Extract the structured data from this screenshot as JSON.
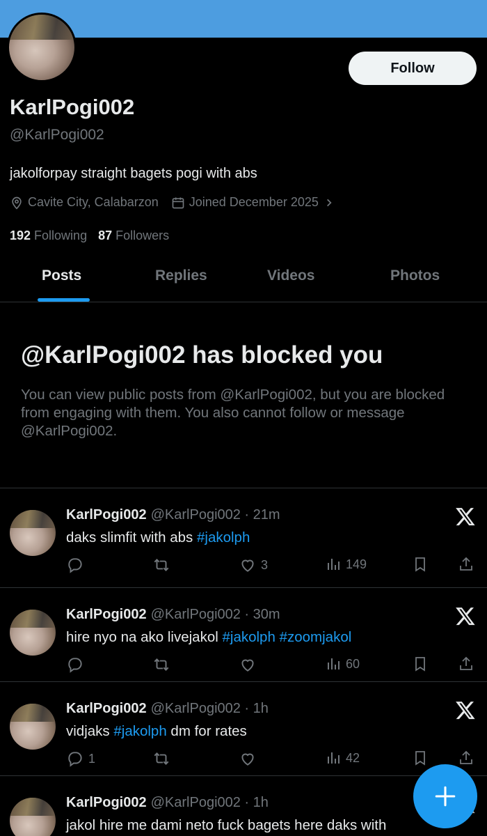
{
  "profile": {
    "name": "KarlPogi002",
    "handle": "@KarlPogi002",
    "bio": "jakolforpay straight bagets pogi with abs",
    "location": "Cavite City, Calabarzon",
    "joined": "Joined December 2025",
    "following_count": "192",
    "following_label": "Following",
    "followers_count": "87",
    "followers_label": "Followers",
    "follow_label": "Follow"
  },
  "tabs": [
    "Posts",
    "Replies",
    "Videos",
    "Photos"
  ],
  "blocked": {
    "title": "@KarlPogi002 has blocked you",
    "description": "You can view public posts from @KarlPogi002, but you are blocked from engaging with them. You also cannot follow or message @KarlPogi002."
  },
  "posts": [
    {
      "name": "KarlPogi002",
      "meta": "@KarlPogi002 · 21m",
      "text_parts": [
        {
          "t": "daks slimfit with abs ",
          "tag": false
        },
        {
          "t": "#jakolph",
          "tag": true
        }
      ],
      "replies": "",
      "reposts": "",
      "likes": "3",
      "views": "149"
    },
    {
      "name": "KarlPogi002",
      "meta": "@KarlPogi002 · 30m",
      "text_parts": [
        {
          "t": "hire nyo na ako livejakol ",
          "tag": false
        },
        {
          "t": "#jakolph",
          "tag": true
        },
        {
          "t": " ",
          "tag": false
        },
        {
          "t": "#zoomjakol",
          "tag": true
        }
      ],
      "replies": "",
      "reposts": "",
      "likes": "",
      "views": "60"
    },
    {
      "name": "KarlPogi002",
      "meta": "@KarlPogi002 · 1h",
      "text_parts": [
        {
          "t": "vidjaks ",
          "tag": false
        },
        {
          "t": "#jakolph",
          "tag": true
        },
        {
          "t": " dm for rates",
          "tag": false
        }
      ],
      "replies": "1",
      "reposts": "",
      "likes": "",
      "views": "42"
    },
    {
      "name": "KarlPogi002",
      "meta": "@KarlPogi002 · 1h",
      "text_parts": [
        {
          "t": "jakol hire me dami neto fuck bagets here daks with ",
          "tag": false
        }
      ],
      "replies": "",
      "reposts": "",
      "likes": "",
      "views": ""
    }
  ],
  "icons": {
    "location": "location-pin-icon",
    "calendar": "calendar-icon",
    "compose": "plus-icon",
    "platform": "x-logo-icon"
  },
  "colors": {
    "banner": "#4d9de0",
    "accent": "#1d9bf0",
    "background": "#000000",
    "muted": "#71767b"
  }
}
